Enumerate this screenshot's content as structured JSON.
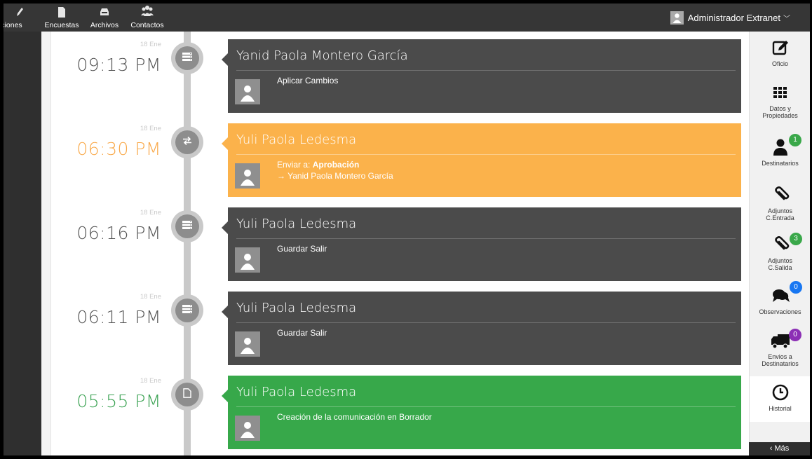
{
  "topnav": {
    "items": [
      {
        "label": "iciones",
        "icon": "pencil-icon"
      },
      {
        "label": "Encuestas",
        "icon": "document-icon"
      },
      {
        "label": "Archivos",
        "icon": "inbox-icon"
      },
      {
        "label": "Contactos",
        "icon": "users-icon"
      }
    ],
    "user_name": "Administrador Extranet"
  },
  "colors": {
    "dark_card": "#4b4b4b",
    "orange_card": "#fbb24b",
    "green_card": "#37a84a",
    "time_gray": "#555555",
    "time_orange": "#f9a94a",
    "time_green": "#3aa252"
  },
  "timeline": [
    {
      "date": "18 Ene",
      "time": "09:13 PM",
      "title": "Yanid Paola Montero García",
      "text": "Aplicar Cambios",
      "variant": "dark",
      "icon": "server-icon"
    },
    {
      "date": "18 Ene",
      "time": "06:30 PM",
      "title": "Yuli Paola Ledesma",
      "send_prefix": "Enviar a:",
      "send_target": "Aprobación",
      "recipient": "→ Yanid Paola Montero García",
      "variant": "orange",
      "icon": "transfer-icon"
    },
    {
      "date": "18 Ene",
      "time": "06:16 PM",
      "title": "Yuli Paola Ledesma",
      "text": "Guardar Salir",
      "variant": "dark",
      "icon": "server-icon"
    },
    {
      "date": "18 Ene",
      "time": "06:11 PM",
      "title": "Yuli Paola Ledesma",
      "text": "Guardar Salir",
      "variant": "dark",
      "icon": "server-icon"
    },
    {
      "date": "18 Ene",
      "time": "05:55 PM",
      "title": "Yuli Paola Ledesma",
      "text": "Creación de la comunicación en Borrador",
      "variant": "green",
      "icon": "file-icon"
    }
  ],
  "right_sidebar": {
    "items": [
      {
        "label": "Oficio",
        "icon": "edit-icon"
      },
      {
        "label": "Datos y Propiedades",
        "label1": "Datos y",
        "label2": "Propiedades",
        "icon": "grid-icon"
      },
      {
        "label": "Destinatarios",
        "icon": "user-icon",
        "badge": "1",
        "badge_color": "#3aa84a"
      },
      {
        "label": "Adjuntos C.Entrada",
        "label1": "Adjuntos",
        "label2": "C.Entrada",
        "icon": "paperclip-icon"
      },
      {
        "label": "Adjuntos C.Salida",
        "label1": "Adjuntos",
        "label2": "C.Salida",
        "icon": "paperclip-icon",
        "badge": "3",
        "badge_color": "#3aa84a"
      },
      {
        "label": "Observaciones",
        "icon": "comments-icon",
        "badge": "0",
        "badge_color": "#1877f2"
      },
      {
        "label": "Envios a Destinatarios",
        "label1": "Envios a",
        "label2": "Destinatarios",
        "icon": "truck-icon",
        "badge": "0",
        "badge_color": "#8c2fb5"
      },
      {
        "label": "Historial",
        "icon": "clock-icon",
        "active": true
      }
    ],
    "more_label": "‹ Más"
  }
}
